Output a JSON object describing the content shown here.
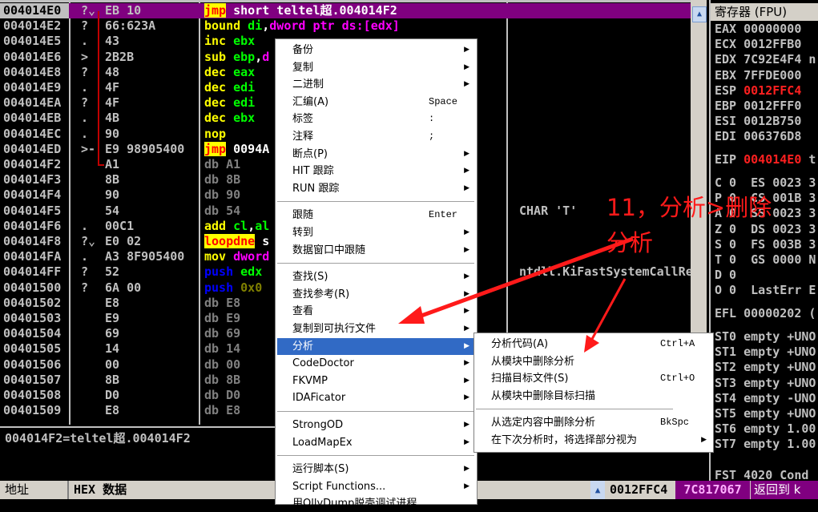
{
  "disasm": {
    "rows": [
      {
        "addr": "004014E0",
        "mark": "?⌄",
        "bytes": "EB 10",
        "selected": true,
        "dis": [
          [
            "jmp",
            "hl"
          ],
          [
            " short teltel超.004014F2",
            "#ffffff"
          ]
        ]
      },
      {
        "addr": "004014E2",
        "mark": "?",
        "bytes": "66:623A",
        "dis": [
          [
            "bound",
            "#ffff00"
          ],
          [
            " di",
            "#00ff00"
          ],
          [
            ",",
            "#ffffff"
          ],
          [
            "dword ptr ds:[edx]",
            "#ff00ff"
          ]
        ]
      },
      {
        "addr": "004014E5",
        "mark": ".",
        "bytes": "43",
        "dis": [
          [
            "inc",
            "#ffff00"
          ],
          [
            " ebx",
            "#00ff00"
          ]
        ]
      },
      {
        "addr": "004014E6",
        "mark": ">",
        "bytes": "2B2B",
        "dis": [
          [
            "sub",
            "#ffff00"
          ],
          [
            " ebp",
            "#00ff00"
          ],
          [
            ",",
            "#ffffff"
          ],
          [
            "d",
            "#ff00ff"
          ]
        ]
      },
      {
        "addr": "004014E8",
        "mark": "?",
        "bytes": "48",
        "dis": [
          [
            "dec",
            "#ffff00"
          ],
          [
            " eax",
            "#00ff00"
          ]
        ]
      },
      {
        "addr": "004014E9",
        "mark": ".",
        "bytes": "4F",
        "dis": [
          [
            "dec",
            "#ffff00"
          ],
          [
            " edi",
            "#00ff00"
          ]
        ]
      },
      {
        "addr": "004014EA",
        "mark": "?",
        "bytes": "4F",
        "dis": [
          [
            "dec",
            "#ffff00"
          ],
          [
            " edi",
            "#00ff00"
          ]
        ]
      },
      {
        "addr": "004014EB",
        "mark": ".",
        "bytes": "4B",
        "dis": [
          [
            "dec",
            "#ffff00"
          ],
          [
            " ebx",
            "#00ff00"
          ]
        ]
      },
      {
        "addr": "004014EC",
        "mark": ".",
        "bytes": "90",
        "dis": [
          [
            "nop",
            "#ffff00"
          ]
        ]
      },
      {
        "addr": "004014ED",
        "mark": ">-",
        "bytes": "E9 98905400",
        "dis": [
          [
            "jmp",
            "hl"
          ],
          [
            " 0094A",
            "#ffffff"
          ]
        ]
      },
      {
        "addr": "004014F2",
        "mark": "",
        "bytes": "A1",
        "dis": [
          [
            "db A1",
            "#808080"
          ]
        ]
      },
      {
        "addr": "004014F3",
        "mark": "",
        "bytes": "8B",
        "dis": [
          [
            "db 8B",
            "#808080"
          ]
        ]
      },
      {
        "addr": "004014F4",
        "mark": "",
        "bytes": "90",
        "dis": [
          [
            "db 90",
            "#808080"
          ]
        ]
      },
      {
        "addr": "004014F5",
        "mark": "",
        "bytes": "54",
        "dis": [
          [
            "db 54",
            "#808080"
          ]
        ]
      },
      {
        "addr": "004014F6",
        "mark": ".",
        "bytes": "00C1",
        "dis": [
          [
            "add",
            "#ffff00"
          ],
          [
            " cl",
            "#00ff00"
          ],
          [
            ",",
            "#ffffff"
          ],
          [
            "al",
            "#00ff00"
          ]
        ]
      },
      {
        "addr": "004014F8",
        "mark": "?⌄",
        "bytes": "E0 02",
        "dis": [
          [
            "loopdne",
            "hl"
          ],
          [
            " s",
            "#ffffff"
          ]
        ]
      },
      {
        "addr": "004014FA",
        "mark": ".",
        "bytes": "A3 8F905400",
        "dis": [
          [
            "mov",
            "#ffff00"
          ],
          [
            " dword",
            "#ff00ff"
          ]
        ]
      },
      {
        "addr": "004014FF",
        "mark": "?",
        "bytes": "52",
        "dis": [
          [
            "push",
            "#0000ff"
          ],
          [
            " edx",
            "#00ff00"
          ]
        ]
      },
      {
        "addr": "00401500",
        "mark": "?",
        "bytes": "6A 00",
        "dis": [
          [
            "push",
            "#0000ff"
          ],
          [
            " 0x0",
            "#808000"
          ]
        ]
      },
      {
        "addr": "00401502",
        "mark": "",
        "bytes": "E8",
        "dis": [
          [
            "db E8",
            "#808080"
          ]
        ]
      },
      {
        "addr": "00401503",
        "mark": "",
        "bytes": "E9",
        "dis": [
          [
            "db E9",
            "#808080"
          ]
        ]
      },
      {
        "addr": "00401504",
        "mark": "",
        "bytes": "69",
        "dis": [
          [
            "db 69",
            "#808080"
          ]
        ]
      },
      {
        "addr": "00401505",
        "mark": "",
        "bytes": "14",
        "dis": [
          [
            "db 14",
            "#808080"
          ]
        ]
      },
      {
        "addr": "00401506",
        "mark": "",
        "bytes": "00",
        "dis": [
          [
            "db 00",
            "#808080"
          ]
        ]
      },
      {
        "addr": "00401507",
        "mark": "",
        "bytes": "8B",
        "dis": [
          [
            "db 8B",
            "#808080"
          ]
        ]
      },
      {
        "addr": "00401508",
        "mark": "",
        "bytes": "D0",
        "dis": [
          [
            "db D0",
            "#808080"
          ]
        ]
      },
      {
        "addr": "00401509",
        "mark": "",
        "bytes": "E8",
        "dis": [
          [
            "db E8",
            "#808080"
          ]
        ]
      }
    ],
    "comments": [
      {
        "row": 13,
        "text": "CHAR 'T'"
      },
      {
        "row": 17,
        "text": "ntdll.KiFastSystemCallRet"
      }
    ]
  },
  "info": {
    "text": "004014F2=teltel超.004014F2"
  },
  "registers": {
    "title": "寄存器 (FPU)",
    "lines": [
      {
        "row": 1,
        "name": "EAX",
        "value": "00000000"
      },
      {
        "row": 2,
        "name": "ECX",
        "value": "0012FFB0"
      },
      {
        "row": 3,
        "name": "EDX",
        "value": "7C92E4F4",
        "extra": "n"
      },
      {
        "row": 4,
        "name": "EBX",
        "value": "7FFDE000"
      },
      {
        "row": 5,
        "name": "ESP",
        "value": "0012FFC4",
        "changed": true
      },
      {
        "row": 6,
        "name": "EBP",
        "value": "0012FFF0"
      },
      {
        "row": 7,
        "name": "ESI",
        "value": "0012B750"
      },
      {
        "row": 8,
        "name": "EDI",
        "value": "006376D8"
      },
      {
        "row": 9.5,
        "name": "EIP",
        "value": "004014E0",
        "changed": true,
        "extra": "t"
      },
      {
        "row": 11,
        "name": "C 0",
        "value": " ES 0023 3"
      },
      {
        "row": 12,
        "name": "P 0",
        "value": " CS 001B 3"
      },
      {
        "row": 13,
        "name": "A 0",
        "value": " SS 0023 3"
      },
      {
        "row": 14,
        "name": "Z 0",
        "value": " DS 0023 3"
      },
      {
        "row": 15,
        "name": "S 0",
        "value": " FS 003B 3"
      },
      {
        "row": 16,
        "name": "T 0",
        "value": " GS 0000 N"
      },
      {
        "row": 17,
        "name": "D 0",
        "value": ""
      },
      {
        "row": 18,
        "name": "O 0",
        "value": " LastErr E"
      },
      {
        "row": 19.5,
        "name": "EFL",
        "value": "00000202 ("
      },
      {
        "row": 21,
        "name": "ST0",
        "value": "empty +UNO"
      },
      {
        "row": 22,
        "name": "ST1",
        "value": "empty +UNO"
      },
      {
        "row": 23,
        "name": "ST2",
        "value": "empty +UNO"
      },
      {
        "row": 24,
        "name": "ST3",
        "value": "empty +UNO"
      },
      {
        "row": 25,
        "name": "ST4",
        "value": "empty -UNO"
      },
      {
        "row": 26,
        "name": "ST5",
        "value": "empty +UNO"
      },
      {
        "row": 27,
        "name": "ST6",
        "value": "empty 1.00"
      },
      {
        "row": 28,
        "name": "ST7",
        "value": "empty 1.00"
      },
      {
        "row": 30,
        "name": "FST",
        "value": "4020 Cond"
      }
    ]
  },
  "bottom": {
    "dump_addr": "地址",
    "dump_hex": "HEX 数据",
    "stack_addr": "0012FFC4",
    "stack_value": "7C817067",
    "stack_comment": "返回到 k"
  },
  "menu": {
    "items": [
      {
        "label": "备份",
        "arrow": true
      },
      {
        "label": "复制",
        "arrow": true
      },
      {
        "label": "二进制",
        "arrow": true
      },
      {
        "label": "汇编(A)",
        "shortcut": "Space"
      },
      {
        "label": "标签",
        "shortcut": ":"
      },
      {
        "label": "注释",
        "shortcut": ";"
      },
      {
        "label": "断点(P)",
        "arrow": true
      },
      {
        "label": "HIT 跟踪",
        "arrow": true
      },
      {
        "label": "RUN 跟踪",
        "arrow": true
      },
      {
        "sep": true
      },
      {
        "label": "跟随",
        "shortcut": "Enter"
      },
      {
        "label": "转到",
        "arrow": true
      },
      {
        "label": "数据窗口中跟随",
        "arrow": true
      },
      {
        "sep": true
      },
      {
        "label": "查找(S)",
        "arrow": true
      },
      {
        "label": "查找参考(R)",
        "arrow": true
      },
      {
        "label": "查看",
        "arrow": true
      },
      {
        "label": "复制到可执行文件",
        "arrow": true
      },
      {
        "label": "分析",
        "arrow": true,
        "active": true
      },
      {
        "label": "CodeDoctor",
        "arrow": true
      },
      {
        "label": "FKVMP",
        "arrow": true
      },
      {
        "label": "IDAFicator",
        "arrow": true
      },
      {
        "sep": true
      },
      {
        "label": "StrongOD",
        "arrow": true
      },
      {
        "label": "LoadMapEx",
        "arrow": true
      },
      {
        "sep": true
      },
      {
        "label": "运行脚本(S)",
        "arrow": true
      },
      {
        "label": "Script Functions...",
        "arrow": true
      },
      {
        "label": "用OllyDump脱壳调试进程"
      }
    ]
  },
  "submenu": {
    "items": [
      {
        "label": "分析代码(A)",
        "shortcut": "Ctrl+A"
      },
      {
        "label": "从模块中删除分析"
      },
      {
        "label": "扫描目标文件(S)",
        "shortcut": "Ctrl+O"
      },
      {
        "label": "从模块中删除目标扫描"
      },
      {
        "sep": true
      },
      {
        "label": "从选定内容中删除分析",
        "shortcut": "BkSpc"
      },
      {
        "label": "在下次分析时，将选择部分视为",
        "arrow": true
      }
    ]
  },
  "annotation": {
    "line1": "11，分析>删除",
    "line2": "分析",
    "color": "#ff1a1a"
  }
}
